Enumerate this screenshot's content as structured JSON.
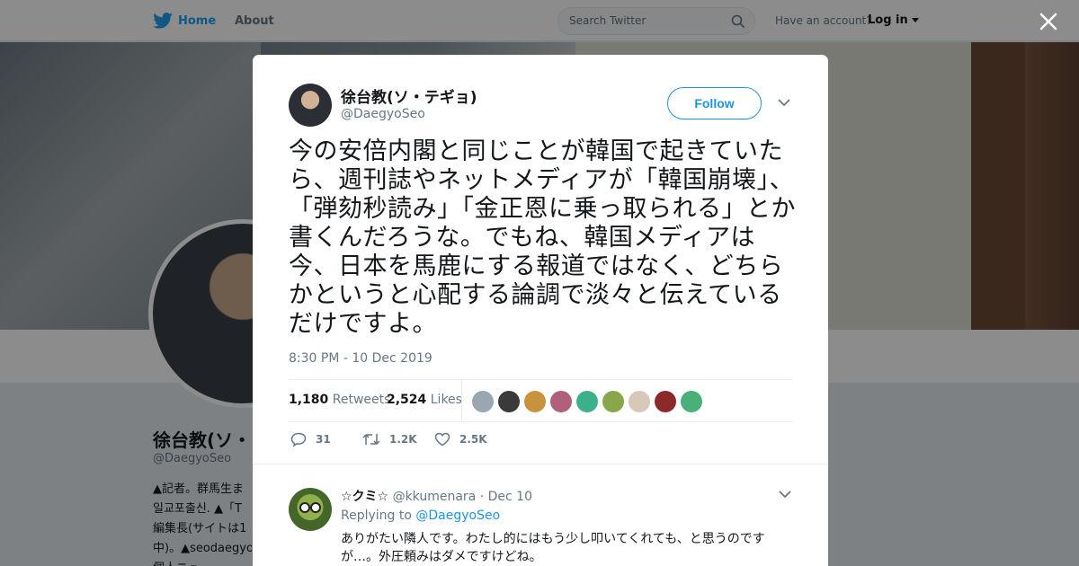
{
  "nav": {
    "home_label": "Home",
    "about_label": "About",
    "search_placeholder": "Search Twitter",
    "account_prompt": "Have an account?",
    "login_label": "Log in"
  },
  "background_profile": {
    "name": "徐台教(ソ・",
    "handle": "@DaegyoSeo",
    "bio_lines": [
      "▲記者。群馬生ま",
      "일교포출신. ▲「T",
      "編集長(サイトは1",
      "中)。▲seodaegyo",
      "個人ニュー"
    ]
  },
  "tweet": {
    "author_name": "徐台教(ソ・テギョ)",
    "author_handle": "@DaegyoSeo",
    "follow_label": "Follow",
    "text": "今の安倍内閣と同じことが韓国で起きていたら、週刊誌やネットメディアが「韓国崩壊」、「弾劾秒読み」「金正恩に乗っ取られる」とか書くんだろうな。でもね、韓国メディアは今、日本を馬鹿にする報道ではなく、どちらかというと心配する論調で淡々と伝えているだけですよ。",
    "timestamp": "8:30 PM - 10 Dec 2019",
    "retweets_count": "1,180",
    "retweets_label": "Retweets",
    "likes_count": "2,524",
    "likes_label": "Likes",
    "liker_colors": [
      "#9aa7b0",
      "#3a3a3a",
      "#c9923c",
      "#b0607a",
      "#3bb08a",
      "#8aa64a",
      "#d8c8b8",
      "#8a2a2a",
      "#4ab07a"
    ],
    "actions": {
      "reply_count": "31",
      "retweet_count": "1.2K",
      "like_count": "2.5K"
    }
  },
  "reply": {
    "name": "☆クミ☆",
    "handle": "@kkumenara",
    "date": "· Dec 10",
    "replying_prefix": "Replying to",
    "replying_to": "@DaegyoSeo",
    "text": "ありがたい隣人です。わたし的にはもう少し叩いてくれても、と思うのですが…。外圧頼みはダメですけどね。"
  },
  "colors": {
    "accent": "#1da1f2",
    "link": "#1b95e0",
    "muted": "#657786"
  }
}
